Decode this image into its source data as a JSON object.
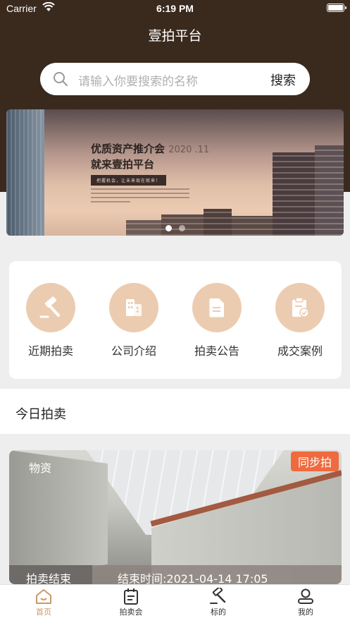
{
  "status_bar": {
    "carrier": "Carrier",
    "time": "6:19 PM"
  },
  "header": {
    "title": "壹拍平台"
  },
  "search": {
    "placeholder": "请输入你要搜索的名称",
    "button_label": "搜索"
  },
  "banner": {
    "headline_line1": "优质资产推介会",
    "year": "2020 .11",
    "headline_line2": "就来壹拍平台",
    "tagline": "把握机会，让未来现在就来！",
    "dots": 2,
    "active_dot": 0
  },
  "categories": [
    {
      "label": "近期拍卖",
      "icon": "gavel-icon"
    },
    {
      "label": "公司介绍",
      "icon": "building-icon"
    },
    {
      "label": "拍卖公告",
      "icon": "document-icon"
    },
    {
      "label": "成交案例",
      "icon": "clipboard-check-icon"
    }
  ],
  "today_section": {
    "title": "今日拍卖"
  },
  "auction_card": {
    "category": "物资",
    "badge": "同步拍",
    "status": "拍卖结束",
    "end_time": "结束时间:2021-04-14 17:05"
  },
  "tabbar": [
    {
      "label": "首页",
      "icon": "home-icon",
      "active": true
    },
    {
      "label": "拍卖会",
      "icon": "calendar-icon",
      "active": false
    },
    {
      "label": "标的",
      "icon": "gavel-icon",
      "active": false
    },
    {
      "label": "我的",
      "icon": "user-icon",
      "active": false
    }
  ],
  "colors": {
    "header_bg": "#3a2a1e",
    "accent": "#c89a6a",
    "category_circle": "#ecccb0",
    "sync_badge": "#ef6a3e"
  }
}
